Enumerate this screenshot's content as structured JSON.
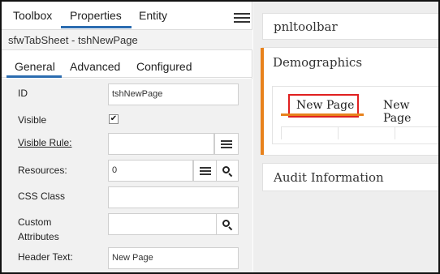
{
  "left_panel": {
    "top_tabs": [
      "Toolbox",
      "Properties",
      "Entity"
    ],
    "path": "sfwTabSheet - tshNewPage",
    "sub_tabs": [
      "General",
      "Advanced",
      "Configured"
    ],
    "fields": {
      "id_label": "ID",
      "id_value": "tshNewPage",
      "visible_label": "Visible",
      "visible_checked": true,
      "visible_rule_label": "Visible Rule:",
      "visible_rule_value": "",
      "resources_label": "Resources:",
      "resources_value": "0",
      "css_class_label": "CSS Class",
      "css_class_value": "",
      "custom_attributes_label_line1": "Custom",
      "custom_attributes_label_line2": "Attributes",
      "custom_attributes_value": "",
      "header_text_label": "Header Text:",
      "header_text_value": "New Page"
    }
  },
  "right_panel": {
    "toolbar_title": "pnltoolbar",
    "demographics_title": "Demographics",
    "tabs": [
      "New Page",
      "New Page"
    ],
    "audit_title": "Audit Information"
  },
  "colors": {
    "accent_blue": "#2b6cb0",
    "accent_orange": "#e8821c",
    "highlight_red": "#e02020"
  },
  "icons": [
    "hamburger-menu-icon",
    "list-icon",
    "search-icon",
    "checkmark-icon"
  ]
}
